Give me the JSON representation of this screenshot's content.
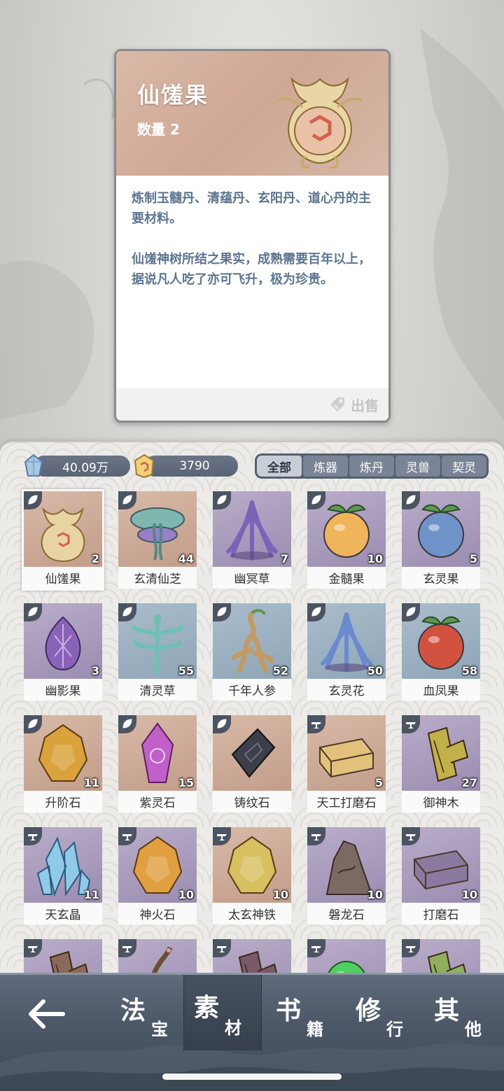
{
  "detail": {
    "name": "仙馐果",
    "quantity_label": "数量",
    "quantity": "2",
    "desc_1": "炼制玉髓丹、清蕴丹、玄阳丹、道心丹的主要材料。",
    "desc_2": "仙馐神树所结之果实，成熟需要百年以上，据说凡人吃了亦可飞升，极为珍贵。",
    "sell_label": "出售"
  },
  "currency": {
    "spirit_stone": "40.09万",
    "gold": "3790"
  },
  "filters": [
    "全部",
    "炼器",
    "炼丹",
    "灵兽",
    "契灵"
  ],
  "items": [
    {
      "name": "仙馐果",
      "count": "2",
      "bg": "tan",
      "badge": "leaf-icon",
      "art": "fruit-pouch-icon",
      "color": "#e8d3a2"
    },
    {
      "name": "玄清仙芝",
      "count": "44",
      "bg": "tan",
      "badge": "leaf-icon",
      "art": "mushroom-icon",
      "color": "#7fb6b0"
    },
    {
      "name": "幽冥草",
      "count": "7",
      "bg": "purple",
      "badge": "leaf-icon",
      "art": "herb-icon",
      "color": "#7a63b8"
    },
    {
      "name": "金髓果",
      "count": "10",
      "bg": "purple",
      "badge": "leaf-icon",
      "art": "fruit-icon",
      "color": "#f0b45a"
    },
    {
      "name": "玄灵果",
      "count": "5",
      "bg": "purple",
      "badge": "leaf-icon",
      "art": "fruit-icon",
      "color": "#6f92c8"
    },
    {
      "name": "幽影果",
      "count": "3",
      "bg": "purple",
      "badge": "leaf-icon",
      "art": "bud-icon",
      "color": "#8a62b8"
    },
    {
      "name": "清灵草",
      "count": "55",
      "bg": "blue",
      "badge": "leaf-icon",
      "art": "sprout-icon",
      "color": "#6fc0b4"
    },
    {
      "name": "千年人参",
      "count": "52",
      "bg": "blue",
      "badge": "leaf-icon",
      "art": "ginseng-icon",
      "color": "#c49a62"
    },
    {
      "name": "玄灵花",
      "count": "50",
      "bg": "blue",
      "badge": "leaf-icon",
      "art": "herb-icon",
      "color": "#6a8ad0"
    },
    {
      "name": "血凤果",
      "count": "58",
      "bg": "blue",
      "badge": "leaf-icon",
      "art": "fruit-icon",
      "color": "#d2523f"
    },
    {
      "name": "升阶石",
      "count": "11",
      "bg": "tan",
      "badge": "leaf-icon",
      "art": "ore-icon",
      "color": "#d9a23a"
    },
    {
      "name": "紫灵石",
      "count": "15",
      "bg": "tan",
      "badge": "leaf-icon",
      "art": "crystal-icon",
      "color": "#c060c8"
    },
    {
      "name": "铸纹石",
      "count": "",
      "bg": "tan",
      "badge": "leaf-icon",
      "art": "slab-icon",
      "color": "#3a3f4a"
    },
    {
      "name": "天工打磨石",
      "count": "5",
      "bg": "tan",
      "badge": "anvil-icon",
      "art": "bar-icon",
      "color": "#e2c27a"
    },
    {
      "name": "御神木",
      "count": "27",
      "bg": "purple",
      "badge": "anvil-icon",
      "art": "wood-icon",
      "color": "#c2b04a"
    },
    {
      "name": "天玄晶",
      "count": "11",
      "bg": "purple",
      "badge": "anvil-icon",
      "art": "crystal-cluster-icon",
      "color": "#8fcbe8"
    },
    {
      "name": "神火石",
      "count": "10",
      "bg": "purple",
      "badge": "anvil-icon",
      "art": "ore-icon",
      "color": "#e0a040"
    },
    {
      "name": "太玄神铁",
      "count": "10",
      "bg": "tan",
      "badge": "anvil-icon",
      "art": "ore-icon",
      "color": "#d8c060"
    },
    {
      "name": "磐龙石",
      "count": "10",
      "bg": "purple",
      "badge": "anvil-icon",
      "art": "rock-icon",
      "color": "#7b6a62"
    },
    {
      "name": "打磨石",
      "count": "10",
      "bg": "purple",
      "badge": "anvil-icon",
      "art": "bar-icon",
      "color": "#8a7aa0"
    },
    {
      "name": "",
      "count": "",
      "bg": "purple",
      "badge": "anvil-icon",
      "art": "wood-icon",
      "color": "#8a6a5a"
    },
    {
      "name": "",
      "count": "",
      "bg": "purple",
      "badge": "anvil-icon",
      "art": "branch-icon",
      "color": "#6a5030"
    },
    {
      "name": "",
      "count": "",
      "bg": "purple",
      "badge": "anvil-icon",
      "art": "wood-icon",
      "color": "#7a5a6a"
    },
    {
      "name": "",
      "count": "",
      "bg": "purple",
      "badge": "anvil-icon",
      "art": "orb-icon",
      "color": "#4fd060"
    },
    {
      "name": "",
      "count": "",
      "bg": "purple",
      "badge": "anvil-icon",
      "art": "wood-icon",
      "color": "#90b060"
    }
  ],
  "nav": {
    "back_icon": "arrow-left-icon",
    "tabs": [
      {
        "big": "法",
        "small": "宝"
      },
      {
        "big": "素",
        "small": "材"
      },
      {
        "big": "书",
        "small": "籍"
      },
      {
        "big": "修",
        "small": "行"
      },
      {
        "big": "其",
        "small": "他"
      }
    ]
  },
  "colors": {
    "accent_text": "#5d7590",
    "panel": "#ecebe8",
    "nav": "#4d5868"
  }
}
